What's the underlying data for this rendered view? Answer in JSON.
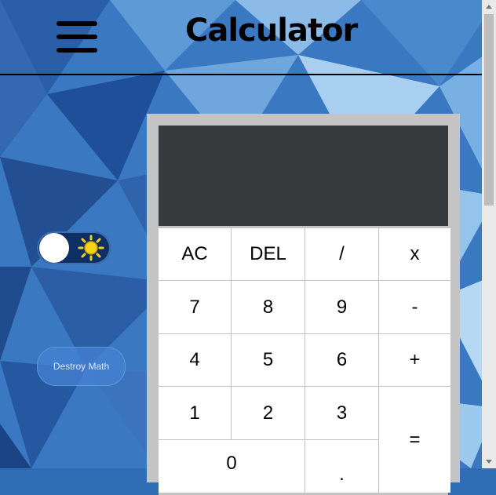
{
  "header": {
    "title": "Calculator",
    "menu_icon": "hamburger-menu-icon"
  },
  "theme_toggle": {
    "icon": "sun-icon",
    "state": "off"
  },
  "destroy_button": {
    "label": "Destroy Math"
  },
  "calculator": {
    "display_value": "",
    "keys": {
      "ac": "AC",
      "del": "DEL",
      "divide": "/",
      "multiply": "x",
      "seven": "7",
      "eight": "8",
      "nine": "9",
      "minus": "-",
      "four": "4",
      "five": "5",
      "six": "6",
      "plus": "+",
      "one": "1",
      "two": "2",
      "three": "3",
      "equals": "=",
      "zero": "0",
      "dot": "."
    }
  },
  "colors": {
    "display_bg": "#373a3d",
    "calc_frame": "#c4c4c4",
    "background_blue": "#2f6db5"
  }
}
